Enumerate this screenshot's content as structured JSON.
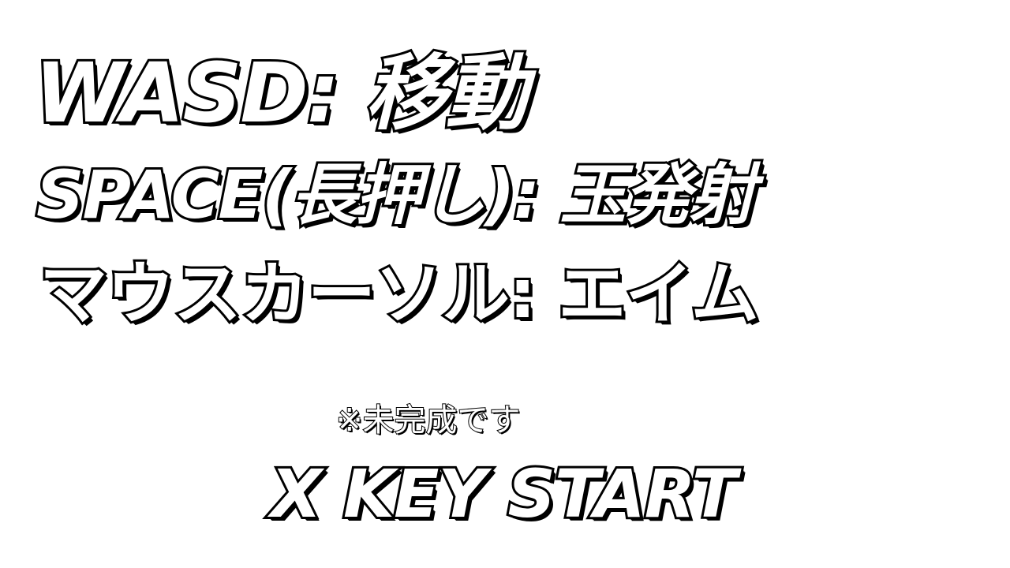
{
  "instructions": {
    "move": {
      "key": "WASD",
      "separator": ":",
      "action": "移動"
    },
    "shoot": {
      "key": "SPACE(長押し)",
      "separator": ":",
      "action": "玉発射"
    },
    "aim": {
      "key": "マウスカーソル",
      "separator": ":",
      "action": "エイム"
    }
  },
  "note": "※未完成です",
  "start_prompt": "X KEY START",
  "colors": {
    "background": "#ffffff",
    "text_fill": "#ffffff",
    "text_outline": "#000000"
  }
}
